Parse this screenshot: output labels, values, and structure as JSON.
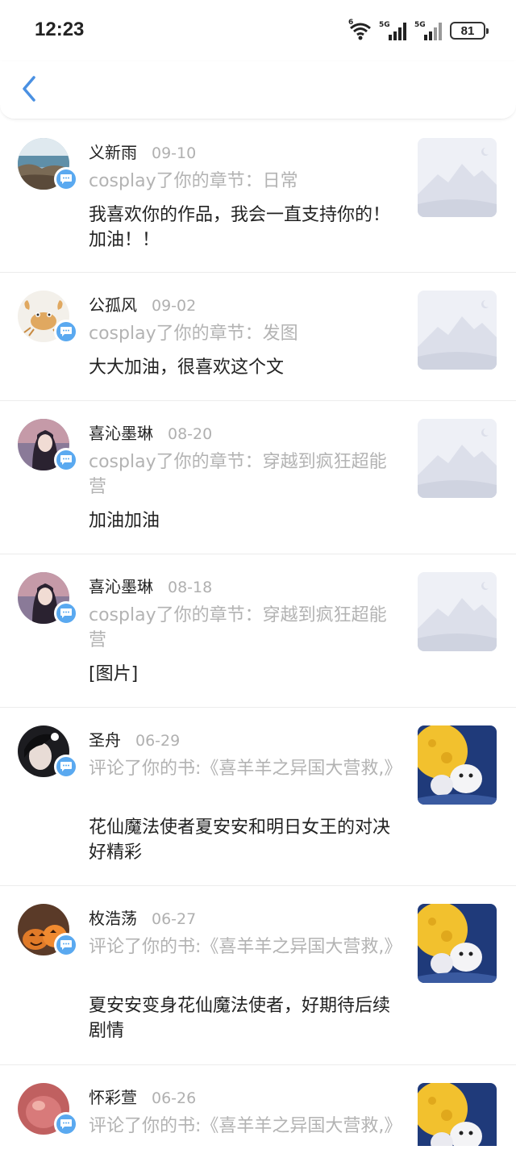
{
  "status_bar": {
    "time": "12:23",
    "net1": "5G",
    "net2": "5G",
    "wifi_label": "6",
    "battery": "81"
  },
  "header": {
    "back_icon": "chevron-left-icon"
  },
  "colors": {
    "accent": "#4a90e2",
    "badge": "#5aa9f0",
    "muted": "#b3b3b3"
  },
  "items": [
    {
      "name": "义新雨",
      "date": "09-10",
      "action": "cosplay了你的章节：日常",
      "comment": "我喜欢你的作品，我会一直支持你的！加油！！",
      "thumb": "placeholder"
    },
    {
      "name": "公孤风",
      "date": "09-02",
      "action": "cosplay了你的章节：发图",
      "comment": "大大加油，很喜欢这个文",
      "thumb": "placeholder"
    },
    {
      "name": "喜沁墨琳",
      "date": "08-20",
      "action": "cosplay了你的章节：穿越到疯狂超能营",
      "comment": "加油加油",
      "thumb": "placeholder"
    },
    {
      "name": "喜沁墨琳",
      "date": "08-18",
      "action": "cosplay了你的章节：穿越到疯狂超能营",
      "comment": "[图片]",
      "thumb": "placeholder"
    },
    {
      "name": "圣舟",
      "date": "06-29",
      "action": "评论了你的书:《喜羊羊之异国大营救,》",
      "comment": "花仙魔法使者夏安安和明日女王的对决好精彩",
      "thumb": "book-cover"
    },
    {
      "name": "枚浩荡",
      "date": "06-27",
      "action": "评论了你的书:《喜羊羊之异国大营救,》",
      "comment": "夏安安变身花仙魔法使者，好期待后续剧情",
      "thumb": "book-cover"
    },
    {
      "name": "怀彩萱",
      "date": "06-26",
      "action": "评论了你的书:《喜羊羊之异国大营救,》",
      "comment": "",
      "thumb": "book-cover"
    }
  ]
}
